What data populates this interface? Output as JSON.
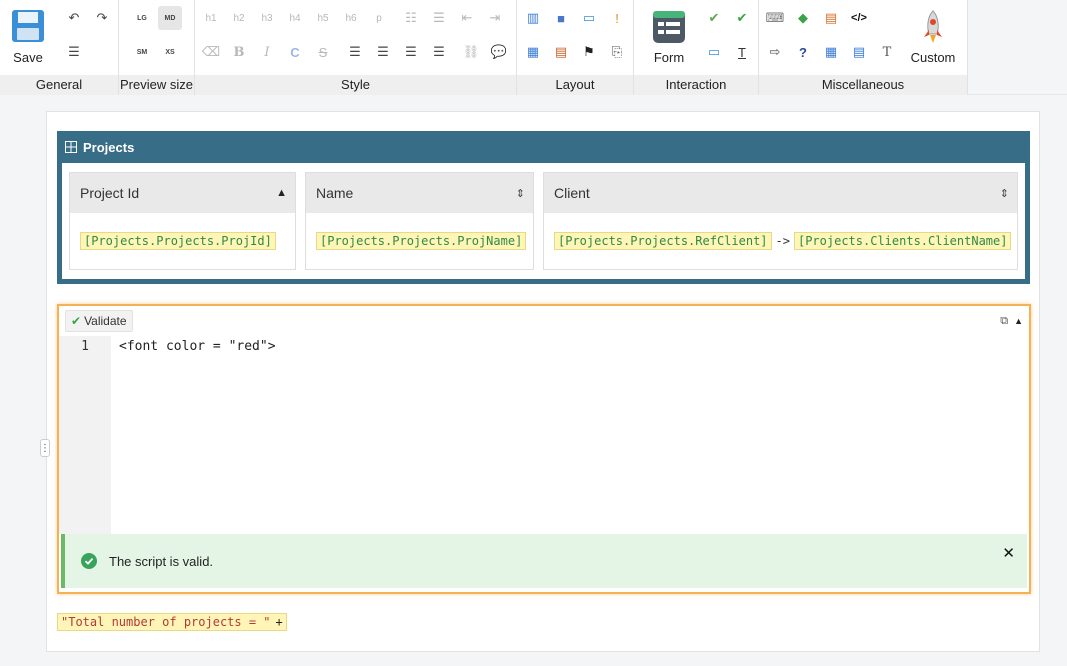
{
  "ribbon": {
    "groups": {
      "general": "General",
      "preview_size": "Preview size",
      "style": "Style",
      "layout": "Layout",
      "interaction": "Interaction",
      "miscellaneous": "Miscellaneous"
    },
    "save_label": "Save",
    "form_label": "Form",
    "custom_label": "Custom",
    "preview_sizes": [
      "LG",
      "MD",
      "SM",
      "XS"
    ],
    "headings": [
      "h1",
      "h2",
      "h3",
      "h4",
      "h5",
      "h6",
      "p"
    ],
    "text_buttons": {
      "bold": "B",
      "italic": "I",
      "color": "C",
      "strike": "S",
      "text_tool": "T"
    }
  },
  "projects": {
    "title": "Projects",
    "columns": [
      {
        "header": "Project Id",
        "value": "[Projects.Projects.ProjId]"
      },
      {
        "header": "Name",
        "value": "[Projects.Projects.ProjName]"
      },
      {
        "header": "Client",
        "value_left": "[Projects.Projects.RefClient]",
        "arrow": "->",
        "value_right": "[Projects.Clients.ClientName]"
      }
    ]
  },
  "editor": {
    "validate_label": "Validate",
    "line_number": "1",
    "code": "<font color = \"red\">",
    "alert_text": "The script is valid.",
    "close_symbol": "✕"
  },
  "footer": {
    "string_literal": "\"Total number of projects = \"",
    "operator": "+"
  },
  "colors": {
    "header_bg": "#386d87",
    "chip_bg": "#fff5b6",
    "chip_text": "#2e8b45",
    "editor_border": "#f5b255",
    "alert_bg": "#e5f5e5",
    "alert_bar": "#6aba6a"
  }
}
